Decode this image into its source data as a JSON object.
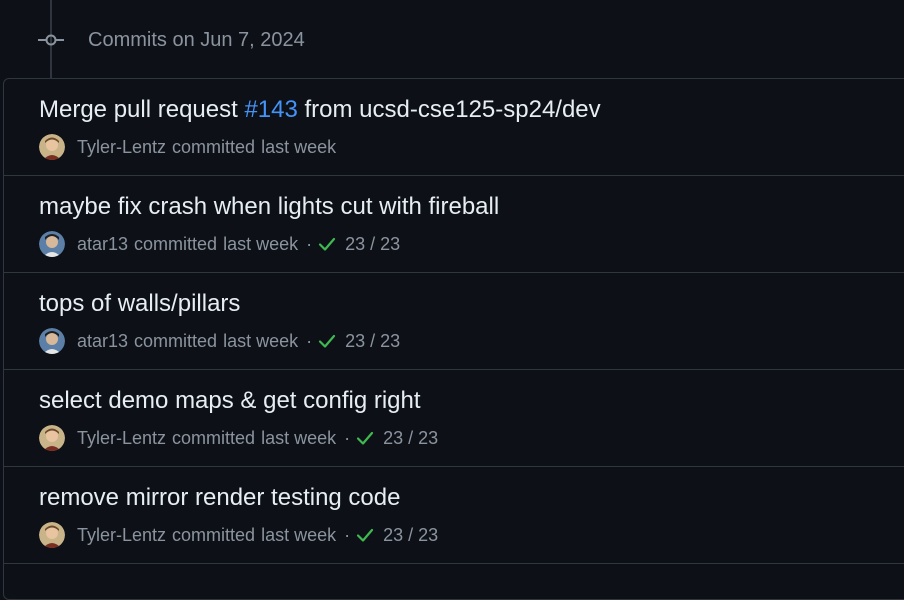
{
  "group": {
    "title": "Commits on Jun 7, 2024"
  },
  "commits": [
    {
      "title_prefix": "Merge pull request ",
      "pr": "#143",
      "title_suffix": " from ucsd-cse125-sp24/dev",
      "author": "Tyler-Lentz",
      "verb": "committed",
      "time": "last week",
      "checks": ""
    },
    {
      "title": "maybe fix crash when lights cut with fireball",
      "author": "atar13",
      "verb": "committed",
      "time": "last week",
      "sep": "·",
      "checks": "23 / 23"
    },
    {
      "title": "tops of walls/pillars",
      "author": "atar13",
      "verb": "committed",
      "time": "last week",
      "sep": "·",
      "checks": "23 / 23"
    },
    {
      "title": "select demo maps & get config right",
      "author": "Tyler-Lentz",
      "verb": "committed",
      "time": "last week",
      "sep": "·",
      "checks": "23 / 23"
    },
    {
      "title": "remove mirror render testing code",
      "author": "Tyler-Lentz",
      "verb": "committed",
      "time": "last week",
      "sep": "·",
      "checks": "23 / 23"
    }
  ],
  "colors": {
    "background": "#0d1117",
    "border": "#30363d",
    "text": "#e6edf3",
    "muted": "#8b949e",
    "link": "#4493f8",
    "success": "#3fb950"
  },
  "icons": {
    "commit": "git-commit-icon",
    "check": "check-icon"
  }
}
